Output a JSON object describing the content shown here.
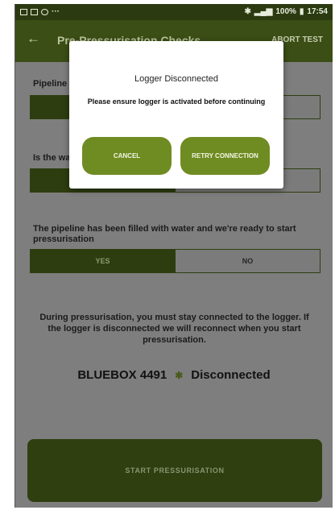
{
  "status_bar": {
    "signal_text": "100%",
    "time": "17:54"
  },
  "header": {
    "back_icon": "arrow-left-icon",
    "title": "Pre-Pressurisation Checks",
    "abort_label": "ABORT TEST"
  },
  "questions": [
    {
      "label": "Pipeline"
    },
    {
      "label": "Is the wa"
    },
    {
      "label": "The pipeline has been filled with water and we're ready to start pressurisation",
      "options": [
        "YES",
        "NO"
      ],
      "selected": "YES"
    }
  ],
  "info": {
    "text": "During pressurisation, you must stay connected to the logger.  If the logger is disconnected we will reconnect when you start pressurisation."
  },
  "device": {
    "name": "BLUEBOX 4491",
    "icon": "bluetooth-icon",
    "status": "Disconnected"
  },
  "start_button": {
    "label": "START PRESSURISATION"
  },
  "dialog": {
    "title": "Logger Disconnected",
    "message": "Please ensure logger is activated before continuing",
    "cancel_label": "CANCEL",
    "retry_label": "RETRY CONNECTION"
  },
  "colors": {
    "app_bar": "#3b4e15",
    "status_bar": "#2b3a10",
    "accent": "#6f8c22",
    "segment_selected": "#2e3d0f",
    "scrim_background": "#7e7e7e"
  }
}
